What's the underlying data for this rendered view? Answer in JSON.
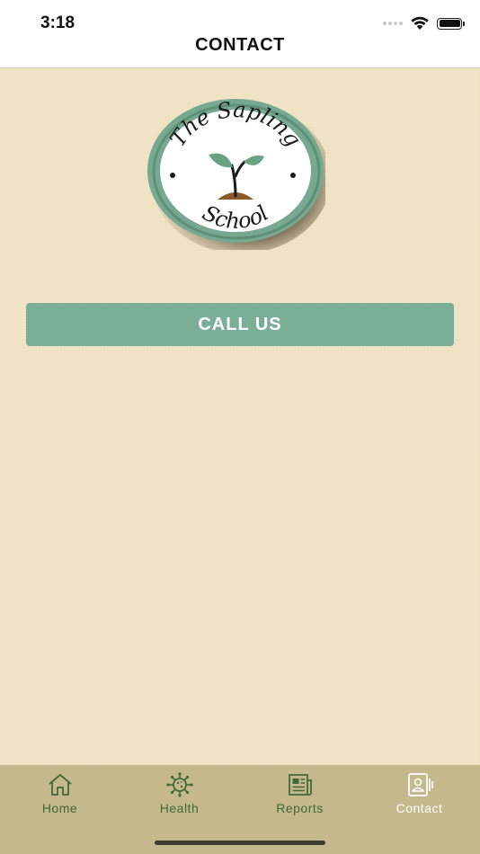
{
  "status_bar": {
    "time": "3:18",
    "icons": [
      "cellular-signal-icon",
      "wifi-icon",
      "battery-icon"
    ]
  },
  "nav": {
    "title": "CONTACT"
  },
  "logo": {
    "text_top": "The Sapling",
    "text_bottom": "School",
    "colors": {
      "ring": "#76a892",
      "leaf": "#6aa284",
      "soil": "#8b5a2b"
    }
  },
  "actions": {
    "call_label": "CALL US"
  },
  "tabs": [
    {
      "label": "Home",
      "icon": "home-icon",
      "active": false
    },
    {
      "label": "Health",
      "icon": "virus-icon",
      "active": false
    },
    {
      "label": "Reports",
      "icon": "newspaper-icon",
      "active": false
    },
    {
      "label": "Contact",
      "icon": "contact-card-icon",
      "active": true
    }
  ],
  "colors": {
    "accent": "#7aae96",
    "background": "#efe3c4",
    "tab_bar": "#c5b88c",
    "tab_text": "#3f6a38",
    "tab_active_text": "#ffffff"
  }
}
